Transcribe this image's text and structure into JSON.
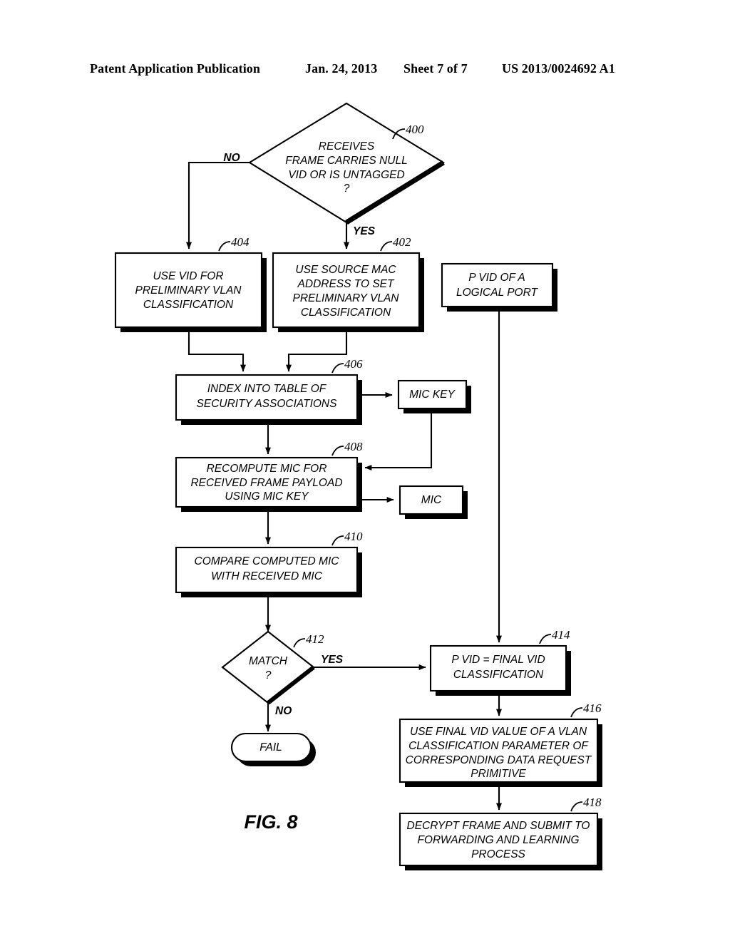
{
  "header": {
    "left": "Patent Application Publication",
    "date": "Jan. 24, 2013",
    "sheet": "Sheet 7 of 7",
    "pubnum": "US 2013/0024692 A1"
  },
  "figure": {
    "caption": "FIG. 8"
  },
  "nodes": {
    "n400": {
      "ref": "400",
      "type": "decision",
      "lines": [
        "RECEIVES",
        "FRAME CARRIES NULL",
        "VID OR IS UNTAGGED",
        "?"
      ]
    },
    "n404": {
      "ref": "404",
      "type": "process",
      "lines": [
        "USE VID FOR",
        "PRELIMINARY VLAN",
        "CLASSIFICATION"
      ]
    },
    "n402": {
      "ref": "402",
      "type": "process",
      "lines": [
        "USE SOURCE MAC",
        "ADDRESS TO SET",
        "PRELIMINARY VLAN",
        "CLASSIFICATION"
      ]
    },
    "npvid": {
      "ref": "",
      "type": "process",
      "lines": [
        "P VID OF A",
        "LOGICAL PORT"
      ]
    },
    "n406": {
      "ref": "406",
      "type": "process",
      "lines": [
        "INDEX INTO TABLE OF",
        "SECURITY ASSOCIATIONS"
      ]
    },
    "nmickey": {
      "ref": "",
      "type": "process",
      "lines": [
        "MIC KEY"
      ]
    },
    "n408": {
      "ref": "408",
      "type": "process",
      "lines": [
        "RECOMPUTE MIC FOR",
        "RECEIVED FRAME PAYLOAD",
        "USING MIC KEY"
      ]
    },
    "nmic": {
      "ref": "",
      "type": "process",
      "lines": [
        "MIC"
      ]
    },
    "n410": {
      "ref": "410",
      "type": "process",
      "lines": [
        "COMPARE COMPUTED MIC",
        "WITH RECEIVED MIC"
      ]
    },
    "n412": {
      "ref": "412",
      "type": "decision",
      "lines": [
        "MATCH",
        "?"
      ]
    },
    "nfail": {
      "ref": "",
      "type": "terminal",
      "lines": [
        "FAIL"
      ]
    },
    "n414": {
      "ref": "414",
      "type": "process",
      "lines": [
        "P VID = FINAL VID",
        "CLASSIFICATION"
      ]
    },
    "n416": {
      "ref": "416",
      "type": "process",
      "lines": [
        "USE FINAL VID VALUE OF A VLAN",
        "CLASSIFICATION PARAMETER OF",
        "CORRESPONDING DATA REQUEST",
        "PRIMITIVE"
      ]
    },
    "n418": {
      "ref": "418",
      "type": "process",
      "lines": [
        "DECRYPT FRAME AND SUBMIT TO",
        "FORWARDING AND LEARNING",
        "PROCESS"
      ]
    }
  },
  "branch_labels": {
    "no_top": "NO",
    "yes_top": "YES",
    "yes_match": "YES",
    "no_match": "NO"
  }
}
